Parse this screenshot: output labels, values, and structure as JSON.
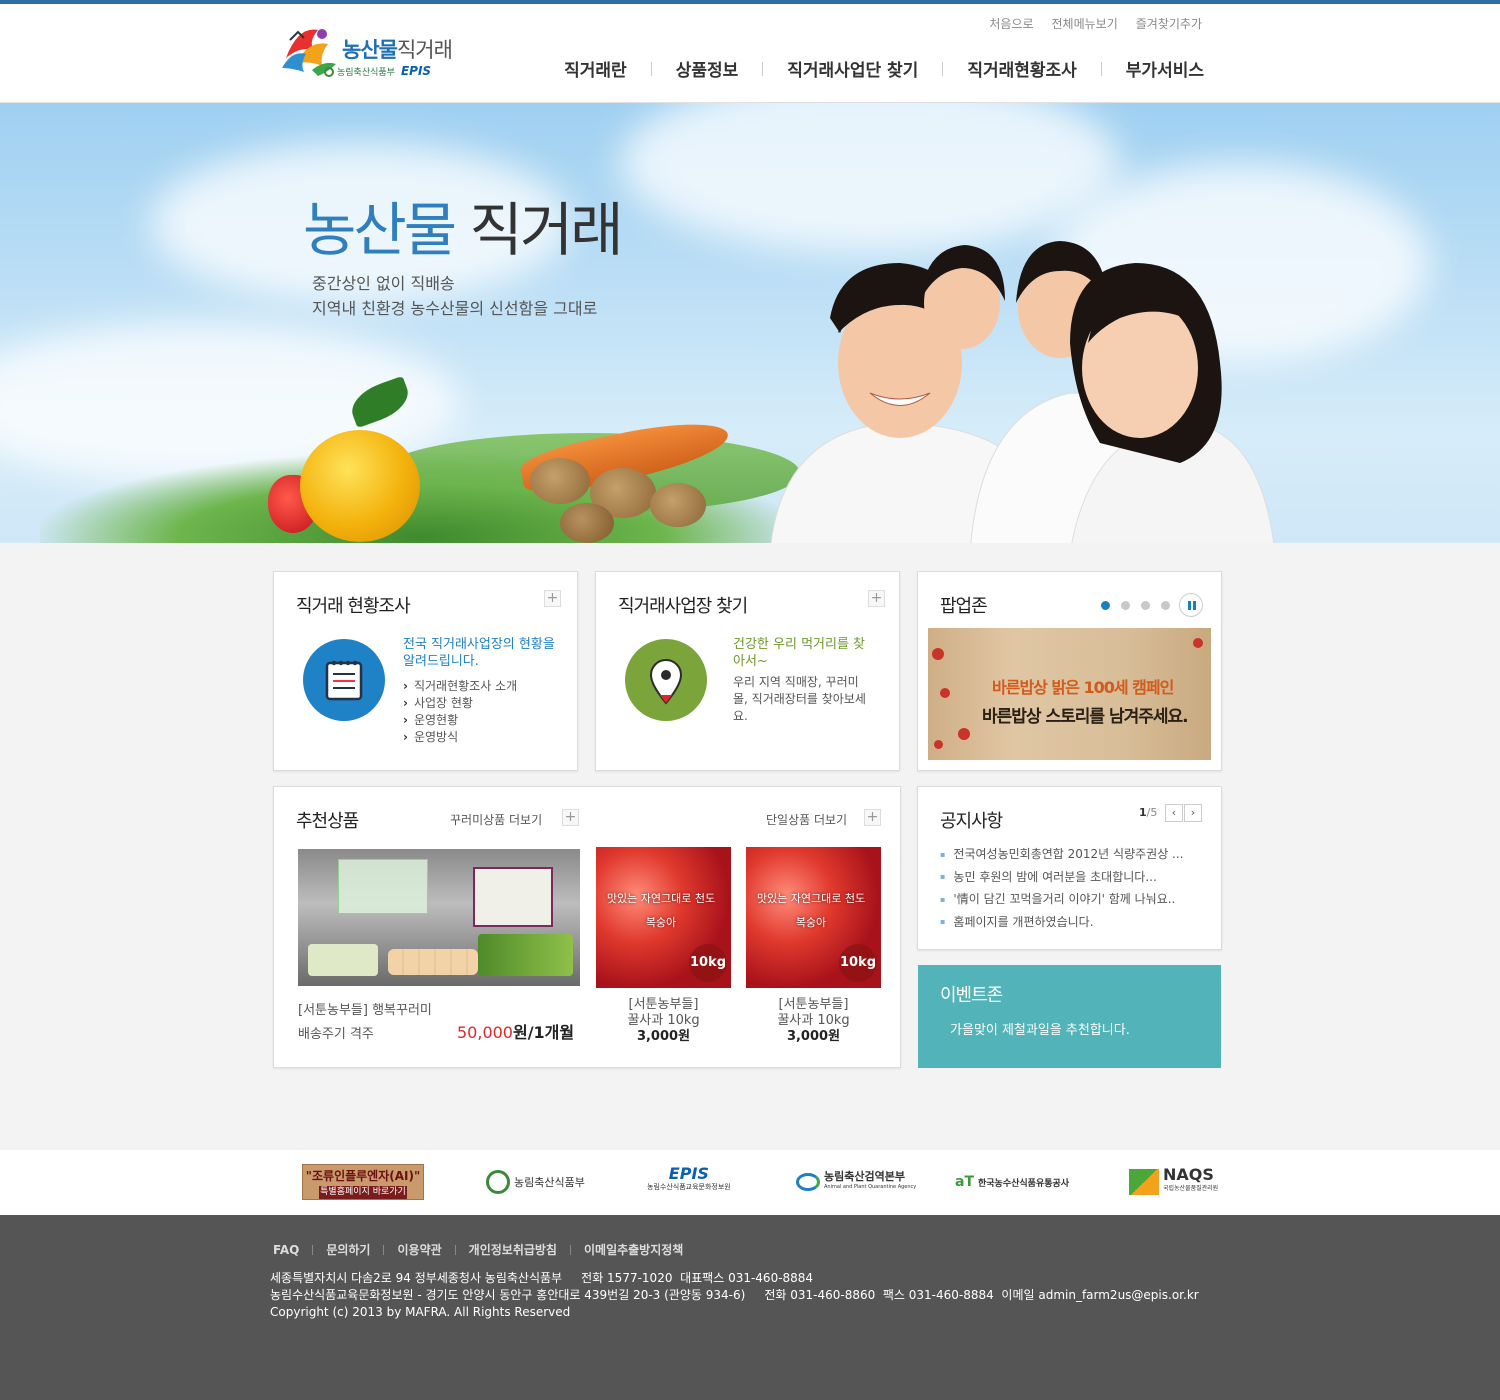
{
  "header": {
    "logo": {
      "title_blue": "농산물",
      "title_dark": "직거래",
      "ministry": "농림축산식품부",
      "epis": "EPIS"
    },
    "util_links": [
      "처음으로",
      "전체메뉴보기",
      "즐겨찾기추가"
    ],
    "nav": [
      "직거래란",
      "상품정보",
      "직거래사업단 찾기",
      "직거래현황조사",
      "부가서비스"
    ]
  },
  "hero": {
    "title_a": "농산물",
    "title_b": "직거래",
    "desc_1": "중간상인 없이 직배송",
    "desc_2": "지역내 친환경 농수산물의 신선함을 그대로"
  },
  "survey": {
    "title": "직거래 현황조사",
    "lead": "전국 직거래사업장의 현황을 알려드립니다.",
    "items": [
      "직거래현황조사 소개",
      "사업장 현황",
      "운영현황",
      "운영방식"
    ]
  },
  "find": {
    "title": "직거래사업장 찾기",
    "lead": "건강한 우리 먹거리를 찾아서~",
    "desc": "우리 지역 직매장, 꾸러미몰, 직거래장터를 찾아보세요."
  },
  "popup": {
    "title": "팝업존",
    "banner_line1": "바른밥상 밝은 100세 캠페인",
    "banner_line2": "바른밥상 스토리를 남겨주세요.",
    "active_dot": 1,
    "dot_count": 4
  },
  "products": {
    "title": "추천상품",
    "more_bundle": "꾸러미상품 더보기",
    "more_single": "단일상품 더보기",
    "main": {
      "name": "[서툰농부들] 행복꾸러미",
      "cycle": "배송주기 격주",
      "price": "50,000",
      "unit": "원/1개월"
    },
    "items": [
      {
        "name": "[서툰농부들]",
        "spec": "꿀사과 10kg",
        "price": "3,000원",
        "badge": "10kg",
        "caption": "맛있는 자연그대로 천도복숭아"
      },
      {
        "name": "[서툰농부들]",
        "spec": "꿀사과 10kg",
        "price": "3,000원",
        "badge": "10kg",
        "caption": "맛있는 자연그대로 천도복숭아"
      }
    ]
  },
  "notice": {
    "title": "공지사항",
    "page_current": "1",
    "page_total": "/5",
    "items": [
      "전국여성농민회총연합 2012년 식량주권상 ...",
      "농민 후원의 밤에 여러분을 초대합니다...",
      "'情이 담긴 꼬먹을거리 이야기' 함께 나눠요..",
      "홈페이지를 개편하였습니다."
    ]
  },
  "event": {
    "title": "이벤트존",
    "desc": "가을맞이 제철과일을 추천합니다."
  },
  "partners": {
    "ai_title": "\"조류인플루엔자(AI)\"",
    "ai_sub": "특별홈페이지 바로가기",
    "mafra": "농림축산식품부",
    "epis": "EPIS",
    "epis_sub": "농림수산식품교육문화정보원",
    "qia": "농림축산검역본부",
    "qia_sub": "Animal and Plant Quarantine Agency",
    "at": "aT",
    "at_name": "한국농수산식품유통공사",
    "naqs": "NAQS",
    "naqs_sub": "국립농산물품질관리원"
  },
  "footer": {
    "nav": [
      "FAQ",
      "문의하기",
      "이용약관",
      "개인정보취급방침",
      "이메일추출방지정책"
    ],
    "line1": "세종특별자치시 다솜2로 94 정부세종청사 농림축산식품부     전화 1577-1020  대표팩스 031-460-8884",
    "line2": "농림수산식품교육문화정보원 - 경기도 안양시 동안구 홍안대로 439번길 20-3 (관양동 934-6)     전화 031-460-8860  팩스 031-460-8884  이메일 admin_farm2us@epis.or.kr",
    "line3": "Copyright (c) 2013 by MAFRA. All Rights Reserved"
  },
  "colors": {
    "brand_blue": "#2f6ea3",
    "accent_blue": "#1a7fc1",
    "green": "#7ba43a",
    "event_teal": "#52b3b8",
    "price_red": "#e0262a",
    "footer_gray": "#555555"
  }
}
